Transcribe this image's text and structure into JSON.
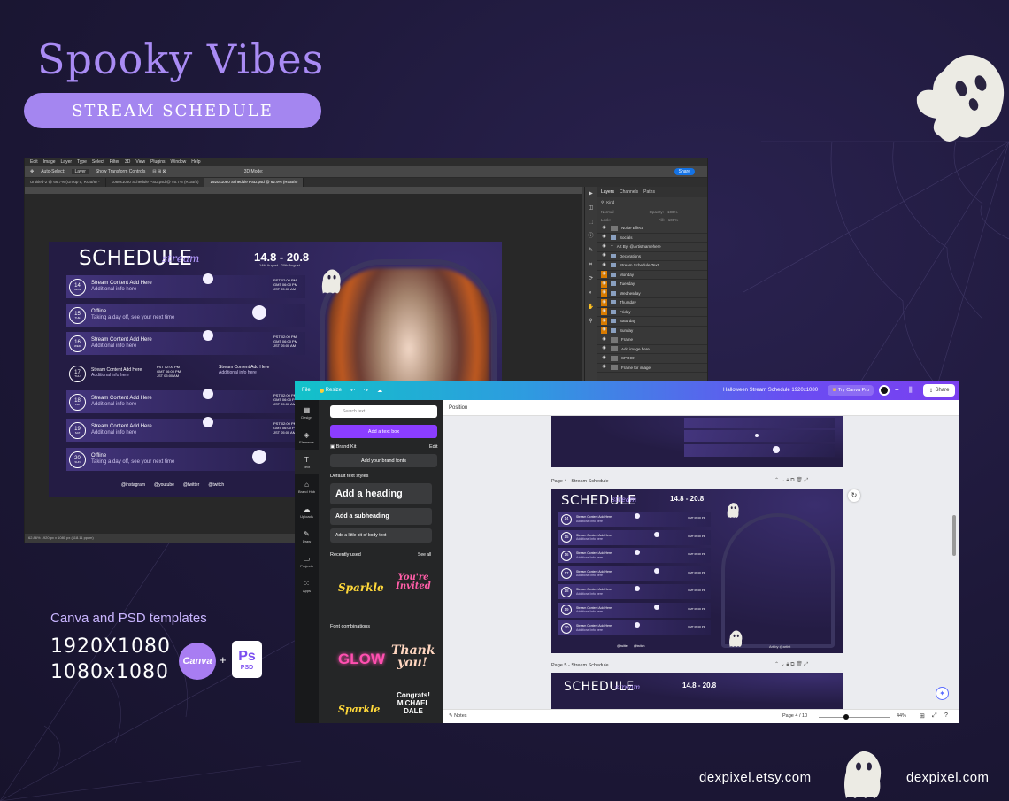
{
  "hero": {
    "title": "Spooky Vibes",
    "pill": "STREAM SCHEDULE"
  },
  "templates": {
    "caption": "Canva and PSD templates",
    "sizes": [
      "1920X1080",
      "1080x1080"
    ],
    "canva_badge": "Canva",
    "plus": "+",
    "ps_logo": "Ps",
    "ps_sub": "PSD"
  },
  "footer": {
    "etsy": "dexpixel.etsy.com",
    "site": "dexpixel.com"
  },
  "photoshop": {
    "menu": [
      "Edit",
      "Image",
      "Layer",
      "Type",
      "Select",
      "Filter",
      "3D",
      "View",
      "Plugins",
      "Window",
      "Help"
    ],
    "options": [
      "Auto-Select:",
      "Layer",
      "Show Transform Controls",
      "3D Mode:"
    ],
    "share": "Share",
    "tabs": [
      "Untitled-2 @ 66.7% (Group 5, RGB/8) *",
      "1080x1080 Schedule PSD.psd @ 46.7% (RGB/8)",
      "1920x1080 Schedule PSD.psd @ 62.9% (RGB/8)"
    ],
    "status": "62.86%     1920 px x 1080 px (118.11 ppcm)",
    "panel_tabs": [
      "Layers",
      "Channels",
      "Paths"
    ],
    "layer_kind": "Kind",
    "layer_mode": "Normal",
    "layer_opacity": "Opacity:",
    "layer_opacity_value": "100%",
    "layer_lock": "Lock:",
    "layer_fill": "Fill:",
    "layer_fill_value": "100%",
    "layers": [
      {
        "name": "Noise Effect",
        "orange": false,
        "type": "layer"
      },
      {
        "name": "Socials",
        "orange": false,
        "type": "folder"
      },
      {
        "name": "Art By: @Artistnamehere",
        "orange": false,
        "type": "text"
      },
      {
        "name": "Decorations",
        "orange": false,
        "type": "folder"
      },
      {
        "name": "Stream Schedule Text",
        "orange": false,
        "type": "folder"
      },
      {
        "name": "Monday",
        "orange": true,
        "type": "folder"
      },
      {
        "name": "Tuesday",
        "orange": true,
        "type": "folder"
      },
      {
        "name": "Wednesday",
        "orange": true,
        "type": "folder"
      },
      {
        "name": "Thursday",
        "orange": true,
        "type": "folder"
      },
      {
        "name": "Friday",
        "orange": true,
        "type": "folder"
      },
      {
        "name": "Saturday",
        "orange": true,
        "type": "folder"
      },
      {
        "name": "Sunday",
        "orange": true,
        "type": "folder"
      },
      {
        "name": "Frame",
        "orange": false,
        "type": "layer"
      },
      {
        "name": "Add image here",
        "orange": false,
        "type": "layer"
      },
      {
        "name": "SPOOK",
        "orange": false,
        "type": "layer"
      },
      {
        "name": "Frame for image",
        "orange": false,
        "type": "layer"
      }
    ]
  },
  "schedule": {
    "title": "SCHEDULE",
    "script": "stream",
    "date_range": "14.8 - 20.8",
    "date_sub": "14th August - 20th August",
    "rows": [
      {
        "day": "14",
        "dow": "MON",
        "title": "Stream Content Add Here",
        "info": "Additional info here",
        "times": [
          "PST 02:00 PM",
          "GMT 06:00 PM",
          "JST 05:00 AM"
        ]
      },
      {
        "day": "15",
        "dow": "TUE",
        "title": "Offline",
        "info": "Taking a day off, see your next time",
        "times": []
      },
      {
        "day": "16",
        "dow": "WED",
        "title": "Stream Content Add Here",
        "info": "Additional info here",
        "times": [
          "PST 02:00 PM",
          "GMT 06:00 PM",
          "JST 05:00 AM"
        ]
      },
      {
        "day": "17",
        "dow": "THU",
        "title": "Stream Content Add Here",
        "info": "Additional info here",
        "times": [
          "PST 02:00 PM",
          "GMT 06:00 PM",
          "JST 05:00 AM"
        ],
        "title2": "Stream Content Add Here",
        "info2": "Additional info here"
      },
      {
        "day": "18",
        "dow": "FRI",
        "title": "Stream Content Add Here",
        "info": "Additional info here",
        "times": [
          "PST 02:00 PM",
          "GMT 06:00 PM",
          "JST 05:00 AM"
        ]
      },
      {
        "day": "19",
        "dow": "SAT",
        "title": "Stream Content Add Here",
        "info": "Additional info here",
        "times": [
          "PST 02:00 PM",
          "GMT 06:00 PM",
          "JST 05:00 AM"
        ]
      },
      {
        "day": "20",
        "dow": "SUN",
        "title": "Offline",
        "info": "Taking a day off, see your next time",
        "times": []
      }
    ],
    "socials": [
      "@instagram",
      "@youtube",
      "@twitter",
      "@twitch"
    ],
    "art_by": "Art by @artist"
  },
  "canva": {
    "file": "File",
    "resize": "Resize",
    "doc_title": "Halloween Stream Schedule 1920x1080",
    "try_pro": "Try Canva Pro",
    "share": "Share",
    "rail": [
      "Design",
      "Elements",
      "Text",
      "Brand Hub",
      "Uploads",
      "Draw",
      "Projects",
      "Apps"
    ],
    "search_placeholder": "Search text",
    "add_textbox": "Add a text box",
    "brand_kit": "Brand Kit",
    "brand_edit": "Edit",
    "add_brand_fonts": "Add your brand fonts",
    "default_styles": "Default text styles",
    "heading": "Add a heading",
    "subheading": "Add a subheading",
    "body": "Add a little bit of body text",
    "recently_used": "Recently used",
    "see_all": "See all",
    "font_combinations": "Font combinations",
    "stickers": [
      "Sparkle",
      "You're Invited",
      "GLOW",
      "Thank you!",
      "Sparkle",
      "Congrats! MICHAEL DALE"
    ],
    "position": "Position",
    "page4_label": "Page 4 - Stream Schedule",
    "page5_label": "Page 5 - Stream Schedule",
    "notes": "Notes",
    "page_counter": "Page 4 / 10",
    "zoom": "44%"
  }
}
